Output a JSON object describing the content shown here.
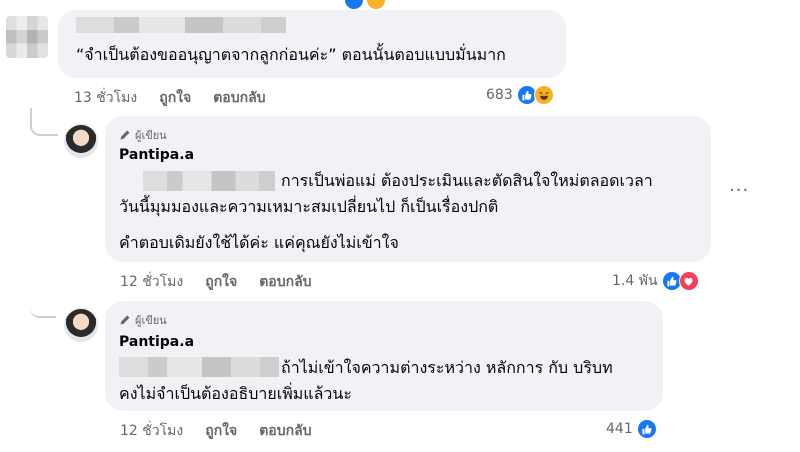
{
  "comments": [
    {
      "text": "“จำเป็นต้องขออนุญาตจากลูกก่อนค่ะ” ตอนนั้นตอบแบบมั่นมาก",
      "time": "13 ชั่วโมง",
      "like_label": "ถูกใจ",
      "reply_label": "ตอบกลับ",
      "reaction_count": "683",
      "reactions": [
        "like-icon",
        "haha-icon"
      ]
    },
    {
      "author_badge": "ผู้เขียน",
      "author": "Pantipa.a",
      "line1": "การเป็นพ่อแม่ ต้องประเมินและตัดสินใจใหม่ตลอดเวลา",
      "line2": "วันนี้มุมมองและความเหมาะสมเปลี่ยนไป ก็เป็นเรื่องปกติ",
      "line3": "คำตอบเดิมยังใช้ได้ค่ะ แค่คุณยังไม่เข้าใจ",
      "time": "12 ชั่วโมง",
      "like_label": "ถูกใจ",
      "reply_label": "ตอบกลับ",
      "reaction_count": "1.4 พัน",
      "reactions": [
        "like-icon",
        "love-icon"
      ],
      "more": "···"
    },
    {
      "author_badge": "ผู้เขียน",
      "author": "Pantipa.a",
      "line1": "ถ้าไม่เข้าใจความต่างระหว่าง หลักการ กับ บริบท",
      "line2": "คงไม่จำเป็นต้องอธิบายเพิ่มแล้วนะ",
      "time": "12 ชั่วโมง",
      "like_label": "ถูกใจ",
      "reply_label": "ตอบกลับ",
      "reaction_count": "441",
      "reactions": [
        "like-icon"
      ]
    }
  ],
  "colors": {
    "like": "#1877f2",
    "love": "#f33e58",
    "haha": "#f7b125",
    "meta": "#65676b",
    "bubble": "#f0f2f5"
  }
}
